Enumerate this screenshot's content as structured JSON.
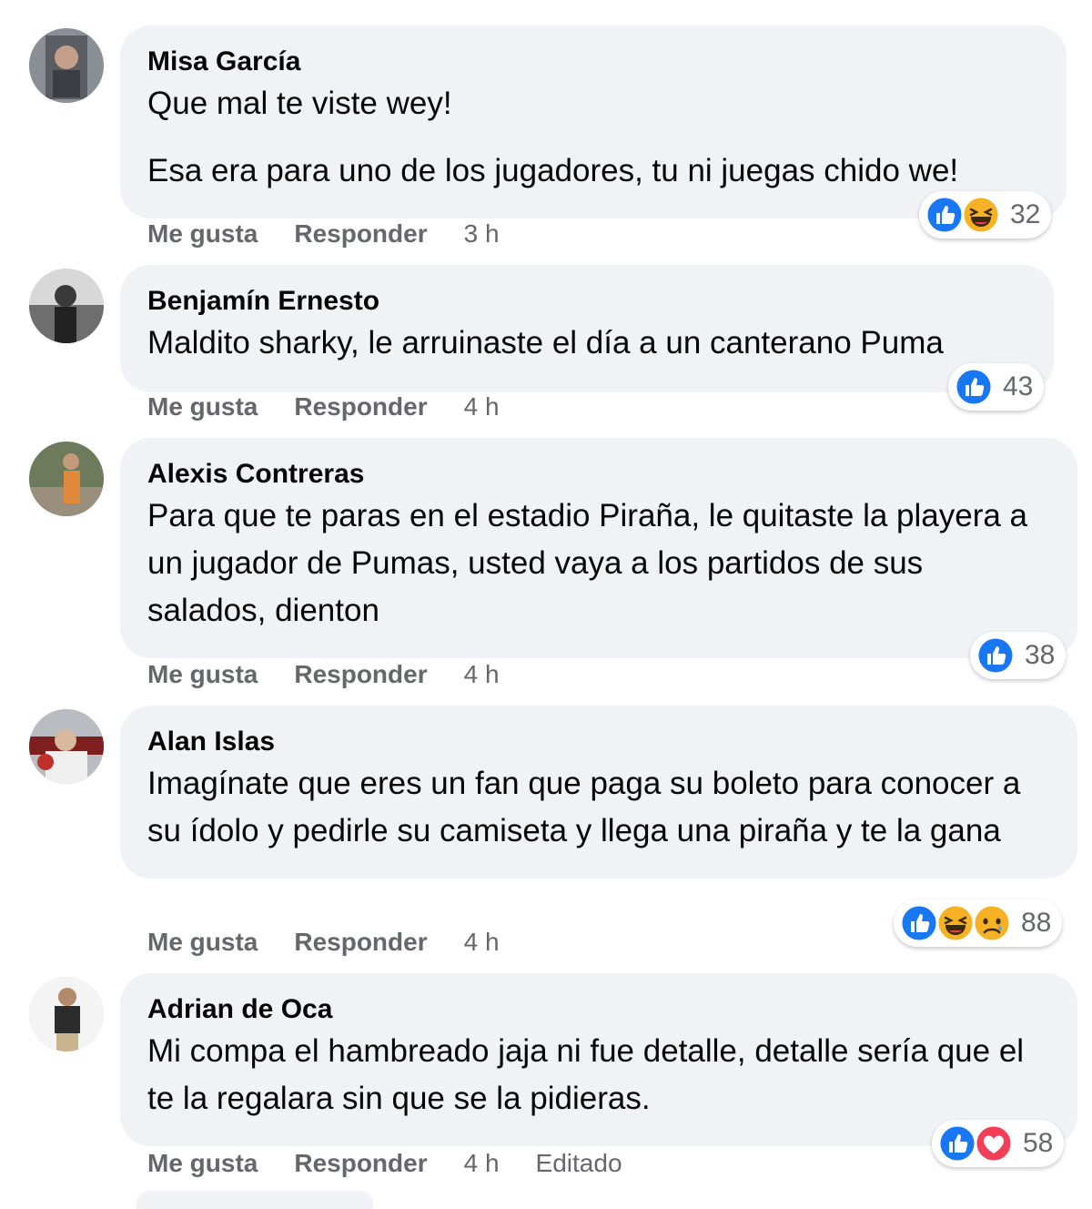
{
  "comments": [
    {
      "author": "Misa García",
      "paragraphs": [
        "Que mal te viste wey!",
        "Esa era para uno de los jugadores, tu ni juegas chido we!"
      ],
      "like_label": "Me gusta",
      "reply_label": "Responder",
      "time": "3 h",
      "reactions": [
        "like",
        "haha"
      ],
      "reaction_count": "32"
    },
    {
      "author": "Benjamín Ernesto",
      "paragraphs": [
        "Maldito sharky, le arruinaste el día a un canterano Puma"
      ],
      "like_label": "Me gusta",
      "reply_label": "Responder",
      "time": "4 h",
      "reactions": [
        "like"
      ],
      "reaction_count": "43"
    },
    {
      "author": "Alexis Contreras",
      "paragraphs": [
        "Para que te paras en el estadio Piraña, le quitaste la playera a un jugador de Pumas, usted vaya a los partidos de sus salados, dienton"
      ],
      "like_label": "Me gusta",
      "reply_label": "Responder",
      "time": "4 h",
      "reactions": [
        "like"
      ],
      "reaction_count": "38"
    },
    {
      "author": "Alan Islas",
      "paragraphs": [
        "Imagínate que eres un fan que paga su boleto para conocer a su ídolo y pedirle su camiseta y llega una piraña y te la gana"
      ],
      "like_label": "Me gusta",
      "reply_label": "Responder",
      "time": "4 h",
      "reactions": [
        "like",
        "haha",
        "sad"
      ],
      "reaction_count": "88"
    },
    {
      "author": "Adrian de Oca",
      "paragraphs": [
        "Mi compa el hambreado jaja ni fue detalle, detalle sería que el te la regalara sin que se la pidieras."
      ],
      "like_label": "Me gusta",
      "reply_label": "Responder",
      "time": "4 h",
      "edited_label": "Editado",
      "reactions": [
        "like",
        "love"
      ],
      "reaction_count": "58"
    }
  ],
  "colors": {
    "bubble_bg": "#f0f2f5",
    "meta_text": "#65676b",
    "like_blue": "#1877f2",
    "haha_yellow": "#f7b125",
    "love_red": "#f33e58"
  }
}
